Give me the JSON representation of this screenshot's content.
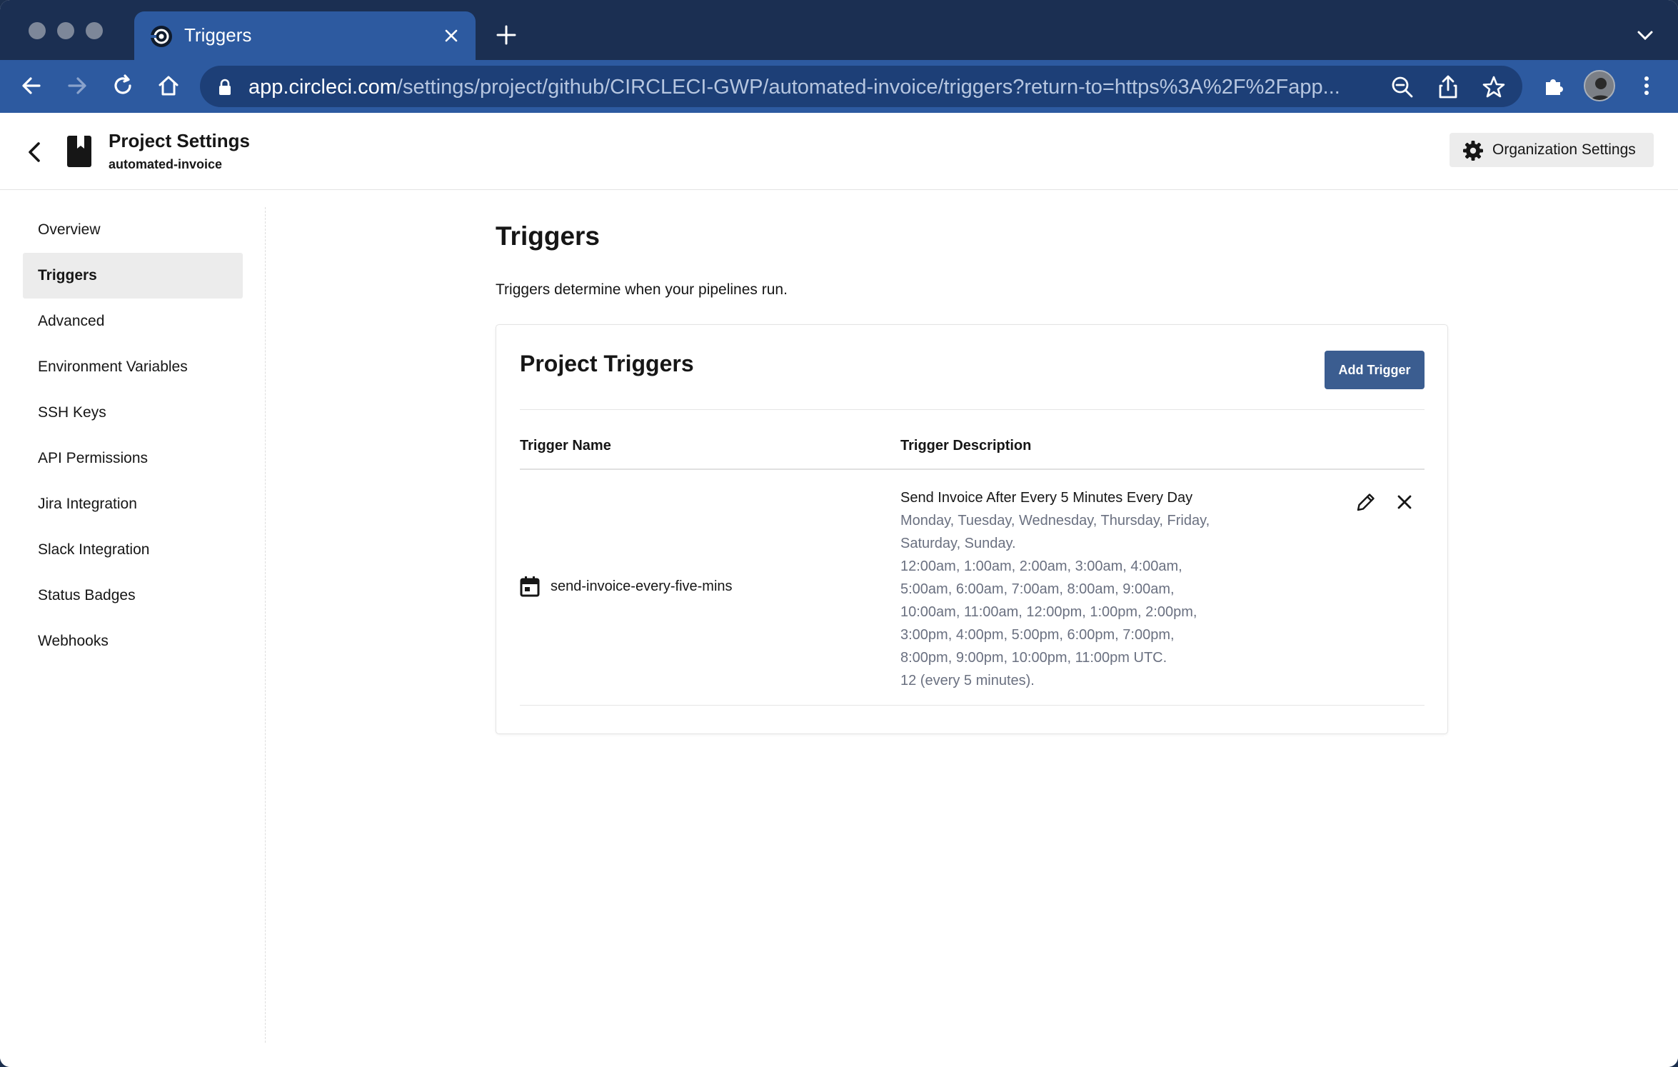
{
  "browser": {
    "tab_title": "Triggers",
    "url_host": "app.circleci.com",
    "url_path": "/settings/project/github/CIRCLECI-GWP/automated-invoice/triggers?return-to=https%3A%2F%2Fapp..."
  },
  "header": {
    "title": "Project Settings",
    "subtitle": "automated-invoice",
    "org_settings_label": "Organization Settings"
  },
  "sidebar": {
    "items": [
      {
        "label": "Overview"
      },
      {
        "label": "Triggers",
        "active": true
      },
      {
        "label": "Advanced"
      },
      {
        "label": "Environment Variables"
      },
      {
        "label": "SSH Keys"
      },
      {
        "label": "API Permissions"
      },
      {
        "label": "Jira Integration"
      },
      {
        "label": "Slack Integration"
      },
      {
        "label": "Status Badges"
      },
      {
        "label": "Webhooks"
      }
    ]
  },
  "main": {
    "title": "Triggers",
    "description": "Triggers determine when your pipelines run.",
    "card": {
      "title": "Project Triggers",
      "add_button": "Add Trigger",
      "col_name": "Trigger Name",
      "col_description": "Trigger Description",
      "rows": [
        {
          "name": "send-invoice-every-five-mins",
          "desc_title": "Send Invoice After Every 5 Minutes Every Day",
          "desc_lines": [
            "Monday, Tuesday, Wednesday, Thursday, Friday,",
            "Saturday, Sunday.",
            "12:00am, 1:00am, 2:00am, 3:00am, 4:00am,",
            "5:00am, 6:00am, 7:00am, 8:00am, 9:00am,",
            "10:00am, 11:00am, 12:00pm, 1:00pm, 2:00pm,",
            "3:00pm, 4:00pm, 5:00pm, 6:00pm, 7:00pm,",
            "8:00pm, 9:00pm, 10:00pm, 11:00pm UTC.",
            "12 (every 5 minutes)."
          ]
        }
      ]
    }
  },
  "icons": {
    "tab_favicon": "circleci-logo-icon",
    "back": "chevron-left-icon",
    "project": "bookmark-icon",
    "org_settings": "gear-icon",
    "trigger": "calendar-icon",
    "edit": "pencil-icon",
    "delete": "close-icon"
  },
  "colors": {
    "tab_bar": "#1b2f52",
    "toolbar": "#2d5aa0",
    "primary_button": "#3b5d90",
    "muted_text": "#6a7080"
  }
}
